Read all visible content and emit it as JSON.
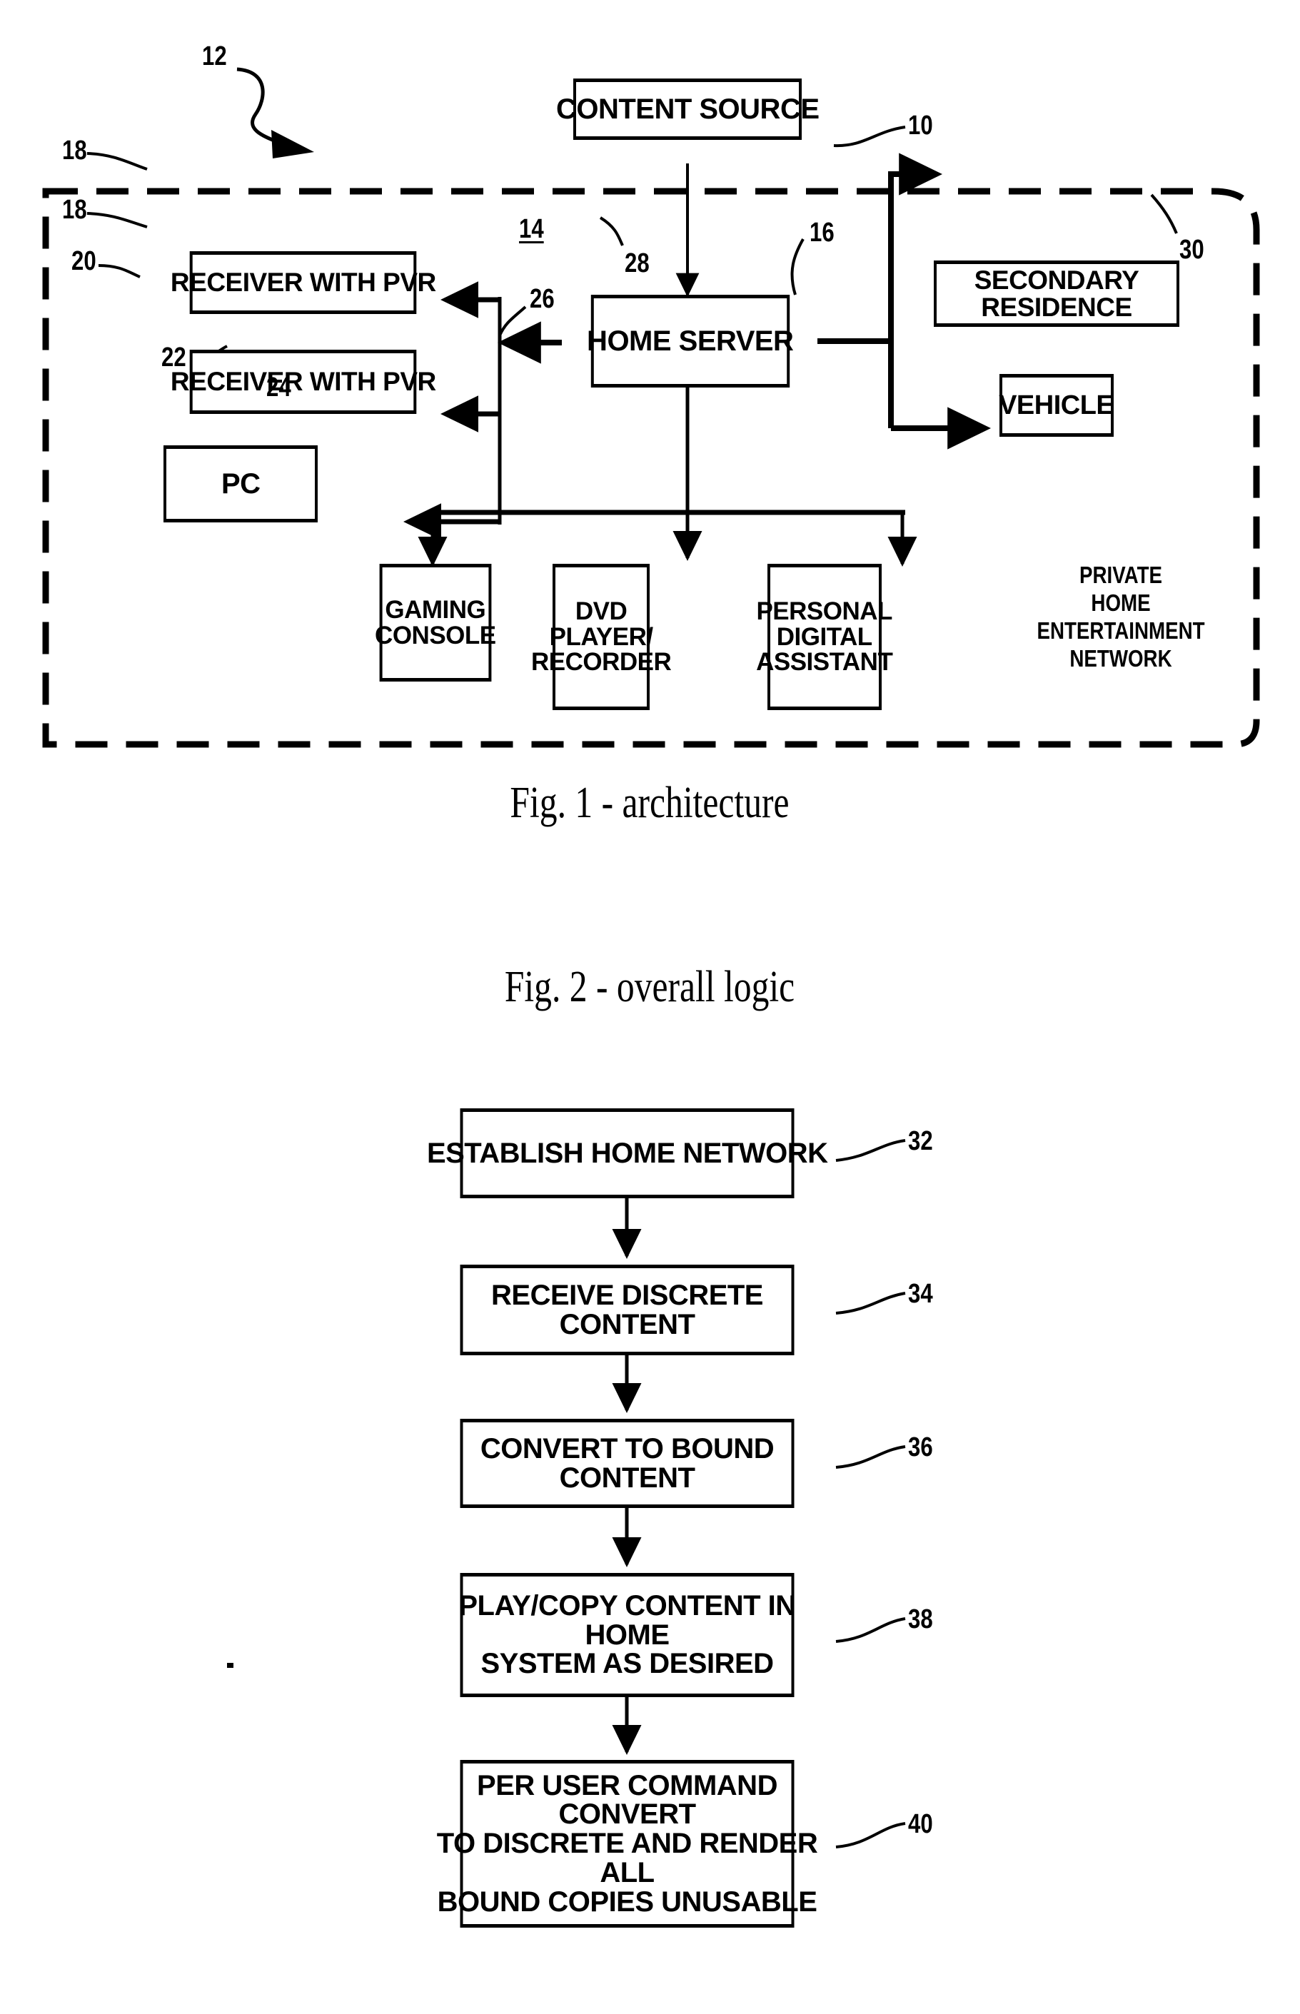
{
  "document": {
    "type": "patent-drawing-sheet",
    "figures": [
      {
        "id": "fig1",
        "caption": "Fig. 1 - architecture",
        "boundary_label": "PRIVATE\nHOME\nENTERTAINMENT\nNETWORK",
        "boundary_ref": "12",
        "nodes": [
          {
            "ref": "10",
            "label": "CONTENT SOURCE"
          },
          {
            "ref": "16",
            "label": "HOME SERVER"
          },
          {
            "ref": "18",
            "label": "RECEIVER WITH PVR"
          },
          {
            "ref": "18",
            "label": "RECEIVER WITH PVR"
          },
          {
            "ref": "20",
            "label": "PC"
          },
          {
            "ref": "22",
            "label": "GAMING\nCONSOLE"
          },
          {
            "ref": "24",
            "label": "DVD\nPLAYER/\nRECORDER"
          },
          {
            "ref": "26",
            "label": "PERSONAL\nDIGITAL\nASSISTANT"
          },
          {
            "ref": "28",
            "label": "VEHICLE"
          },
          {
            "ref": "30",
            "label": "SECONDARY RESIDENCE"
          }
        ],
        "link_ref": "14",
        "refs": [
          "10",
          "12",
          "14",
          "16",
          "18",
          "18",
          "20",
          "22",
          "24",
          "26",
          "28",
          "30"
        ]
      },
      {
        "id": "fig2",
        "caption": "Fig. 2 - overall logic",
        "steps": [
          {
            "ref": "32",
            "label": "ESTABLISH HOME NETWORK"
          },
          {
            "ref": "34",
            "label": "RECEIVE DISCRETE CONTENT"
          },
          {
            "ref": "36",
            "label": "CONVERT TO BOUND CONTENT"
          },
          {
            "ref": "38",
            "label": "PLAY/COPY CONTENT IN HOME\nSYSTEM AS DESIRED"
          },
          {
            "ref": "40",
            "label": "PER USER COMMAND CONVERT\nTO DISCRETE AND RENDER ALL\nBOUND COPIES UNUSABLE"
          }
        ]
      }
    ]
  },
  "fig1": {
    "caption": "Fig. 1 - architecture",
    "ref_12": "12",
    "ref_10": "10",
    "ref_14": "14",
    "ref_16": "16",
    "ref_18a": "18",
    "ref_18b": "18",
    "ref_20": "20",
    "ref_22": "22",
    "ref_24": "24",
    "ref_26": "26",
    "ref_28": "28",
    "ref_30": "30",
    "content_source": "CONTENT SOURCE",
    "home_server": "HOME SERVER",
    "receiver_pvr_1": "RECEIVER WITH PVR",
    "receiver_pvr_2": "RECEIVER WITH PVR",
    "pc": "PC",
    "gaming_console": "GAMING\nCONSOLE",
    "dvd_player": "DVD\nPLAYER/\nRECORDER",
    "pda": "PERSONAL\nDIGITAL\nASSISTANT",
    "vehicle": "VEHICLE",
    "secondary_residence": "SECONDARY RESIDENCE",
    "network_label": "PRIVATE\nHOME\nENTERTAINMENT\nNETWORK"
  },
  "fig2": {
    "caption": "Fig. 2 - overall logic",
    "step1": "ESTABLISH HOME NETWORK",
    "step2": "RECEIVE DISCRETE CONTENT",
    "step3": "CONVERT TO BOUND CONTENT",
    "step4": "PLAY/COPY CONTENT IN HOME\nSYSTEM AS DESIRED",
    "step5": "PER USER COMMAND CONVERT\nTO DISCRETE AND RENDER ALL\nBOUND COPIES UNUSABLE",
    "ref_32": "32",
    "ref_34": "34",
    "ref_36": "36",
    "ref_38": "38",
    "ref_40": "40"
  },
  "colors": {
    "ink": "#000000",
    "paper": "#ffffff"
  }
}
